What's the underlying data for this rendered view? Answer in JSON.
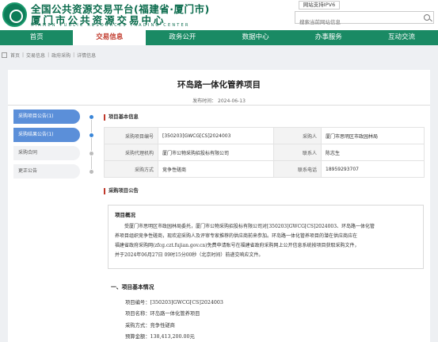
{
  "header": {
    "title_main": "全国公共资源交易平台(福建省·厦门市)",
    "title_sub": "厦门市公共资源交易中心",
    "title_en": "XIAMEN  PUBLIC  RESOURCES  TRADING  CENTER",
    "ipv6_label": "网站支持IPV6",
    "search_placeholder": "搜索当前网站信息"
  },
  "nav": [
    "首页",
    "交易信息",
    "政务公开",
    "数据中心",
    "办事服务",
    "互动交流"
  ],
  "nav_active_index": 1,
  "breadcrumb": [
    "首页",
    "交易信息",
    "政府采购",
    "详情信息"
  ],
  "article": {
    "title": "环岛路一体化管养项目",
    "publish_time": "发布时间： 2024-06-13"
  },
  "side_tabs": [
    {
      "label": "采购项目公告(1)",
      "active": true
    },
    {
      "label": "采购结果公告(1)",
      "active": true
    },
    {
      "label": "采购合同",
      "active": false
    },
    {
      "label": "更正公告",
      "active": false
    }
  ],
  "basic_info": {
    "heading": "项目基本信息",
    "rows": [
      {
        "k1": "采购项目编号",
        "v1": "[350203]GWCG[CS]2024003",
        "k2": "采购人",
        "v2": "厦门市思明区市政园林局"
      },
      {
        "k1": "采购代理机构",
        "v1": "厦门市公物采购招投标有限公司",
        "k2": "联系人",
        "v2": "陈志生"
      },
      {
        "k1": "采购方式",
        "v1": "竞争性磋商",
        "k2": "联系电话",
        "v2": "18959293707"
      }
    ]
  },
  "announcement": {
    "heading": "采购项目公告",
    "overview_title": "项目概况",
    "lines": [
      "受厦门市思明区市政园林局委托，厦门市公物采购招投标有限公司对[350203]GWCG[CS]2024003、环岛路一体化管",
      "养项目组织竞争性磋商，现欢迎采购人及评审专家推荐的供应商前来参加。环岛路一体化管养项目的潜在供应商应在",
      "福建省政府采购网(zfcg.czt.fujian.gov.cn)免费申请账号在福建省政府采购网上公开信息系统按项目获取采购文件，",
      "并于2024年06月27日 09时15分00秒（北京时间）前递交响应文件。"
    ],
    "section_one": "一、项目基本情况",
    "fields": [
      "项目编号：[350203]GWCG[CS]2024003",
      "项目名称：环岛路一体化管养项目",
      "采购方式：竞争性磋商",
      "预算金额：138,413,200.00元"
    ]
  }
}
